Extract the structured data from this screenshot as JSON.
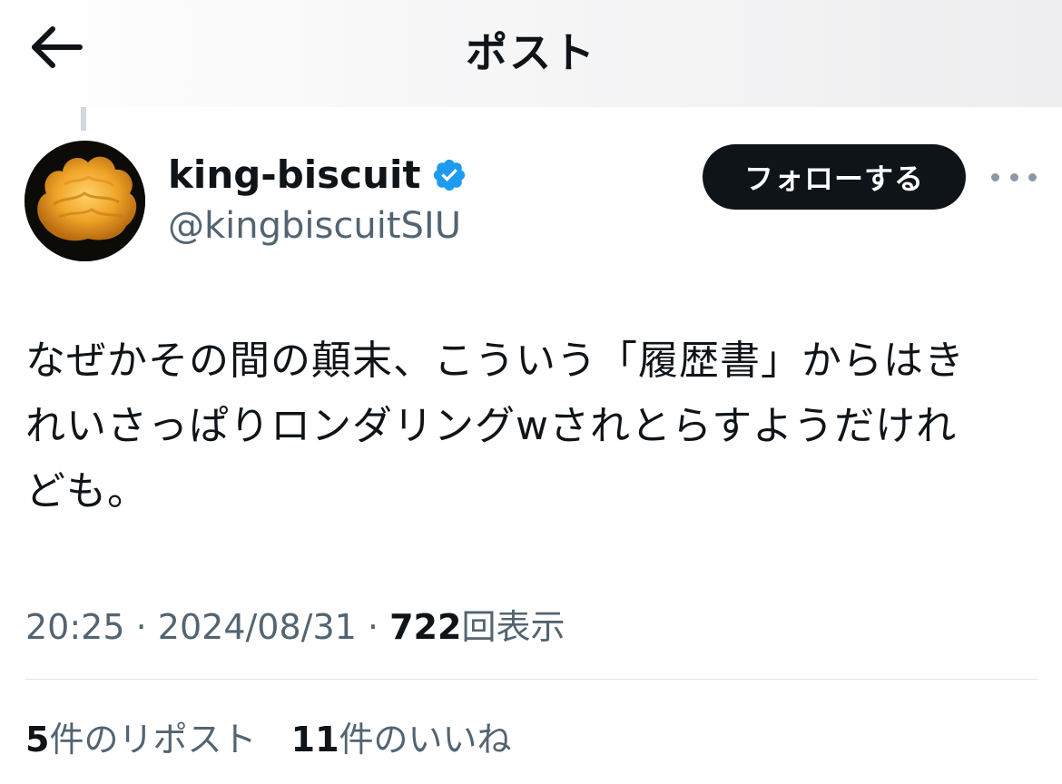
{
  "header": {
    "back_icon": "arrow-left-icon",
    "title": "ポスト"
  },
  "author": {
    "display_name": "king-biscuit",
    "verified_icon": "verified-badge-icon",
    "handle": "@kingbiscuitSIU",
    "avatar_icon": "biscuit-avatar-image"
  },
  "actions": {
    "follow_label": "フォローする",
    "more_icon": "more-horizontal-icon"
  },
  "tweet": {
    "lines": [
      "なぜかその間の顛末、こういう「履歴書」からはき",
      "れいさっぱりロンダリングwされとらすようだけれ",
      "ども。"
    ]
  },
  "meta": {
    "time": "20:25",
    "separator": "·",
    "date": "2024/08/31",
    "views_count": "722",
    "views_label": "回表示"
  },
  "stats": {
    "reposts_count": "5",
    "reposts_label": "件のリポスト",
    "likes_count": "11",
    "likes_label": "件のいいね"
  },
  "colors": {
    "text_primary": "#0f1419",
    "text_secondary": "#536471",
    "verified_blue": "#1d9bf0",
    "follow_bg": "#0f1419"
  }
}
